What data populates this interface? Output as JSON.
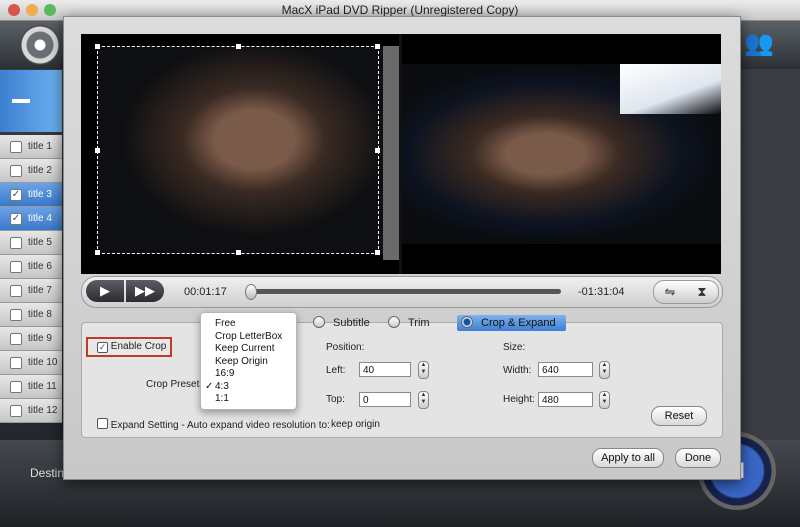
{
  "window": {
    "title": "MacX iPad DVD Ripper (Unregistered Copy)"
  },
  "titles": [
    {
      "label": "title 1",
      "checked": false
    },
    {
      "label": "title 2",
      "checked": false
    },
    {
      "label": "title 3",
      "checked": true
    },
    {
      "label": "title 4",
      "checked": true
    },
    {
      "label": "title 5",
      "checked": false
    },
    {
      "label": "title 6",
      "checked": false
    },
    {
      "label": "title 7",
      "checked": false
    },
    {
      "label": "title 8",
      "checked": false
    },
    {
      "label": "title 9",
      "checked": false
    },
    {
      "label": "title 10",
      "checked": false
    },
    {
      "label": "title 11",
      "checked": false
    },
    {
      "label": "title 12",
      "checked": false
    }
  ],
  "checkmark": "✓",
  "dest_label": "Destination",
  "run_label": "N",
  "player": {
    "play_icon": "▶",
    "ff_icon": "▶▶",
    "current_time": "00:01:17",
    "remaining_time": "-01:31:04",
    "progress": 0.005,
    "flip_h_icon": "⇋",
    "flip_v_icon": "⧗"
  },
  "tabs": {
    "subtitle": "Subtitle",
    "trim": "Trim",
    "crop": "Crop & Expand",
    "partial": "l"
  },
  "crop": {
    "enable_label": "Enable Crop",
    "enable_checked": true,
    "presets_label": "Crop Presets",
    "position_label": "Position:",
    "size_label": "Size:",
    "left_label": "Left:",
    "left_value": "40",
    "top_label": "Top:",
    "top_value": "0",
    "width_label": "Width:",
    "width_value": "640",
    "height_label": "Height:",
    "height_value": "480",
    "reset_label": "Reset",
    "expand_label": "Expand Setting - Auto expand video resolution to:",
    "expand_value": "keep origin"
  },
  "preset_menu": {
    "items": [
      "Free",
      "Crop LetterBox",
      "Keep Current",
      "Keep Origin",
      "16:9",
      "4:3",
      "1:1"
    ],
    "selected": "4:3"
  },
  "buttons": {
    "apply_all": "Apply to all",
    "done": "Done"
  },
  "colors": {
    "accent": "#3d7ed4",
    "highlight_border": "#c0392b"
  }
}
